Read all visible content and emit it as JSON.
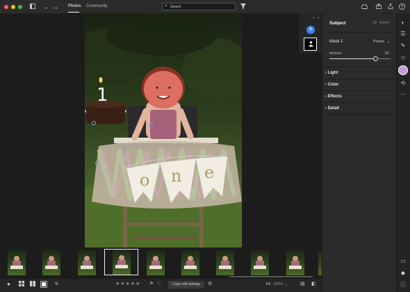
{
  "window": {
    "traffic_lights": [
      "#ff5f57",
      "#febc2e",
      "#28c840"
    ]
  },
  "toolbar": {
    "tabs": [
      {
        "label": "Photos",
        "active": true
      },
      {
        "label": "Community",
        "active": false
      }
    ],
    "search": {
      "placeholder": "Search"
    },
    "icons": [
      "sidebar-toggle-icon",
      "back-arrow-icon",
      "forward-arrow-icon",
      "search-icon",
      "filter-icon",
      "cloud-icon",
      "share-icon",
      "export-icon",
      "help-icon"
    ]
  },
  "masking": {
    "add_button_icon": "plus-icon",
    "mask_thumbnail_icon": "person-icon"
  },
  "panel": {
    "title": "Subject",
    "invert_label": "Invert",
    "mask_name": "Mask 1",
    "preset_label": "Preset",
    "amount": {
      "label": "Amount",
      "value": "50"
    },
    "sections": [
      "Light",
      "Color",
      "Effects",
      "Detail"
    ]
  },
  "rail": {
    "icons": [
      "edit-icon",
      "sliders-icon",
      "heal-icon",
      "eraser-icon",
      "masking-icon",
      "history-icon",
      "more-icon",
      "comment-icon",
      "tag-icon",
      "info-icon"
    ]
  },
  "photo": {
    "banner_letters": [
      "o",
      "n",
      "e"
    ],
    "candle_number": "1"
  },
  "filmstrip": {
    "selected_index": 3,
    "count": 10
  },
  "bottombar": {
    "copy_button": "Copy edit settings",
    "fit_label": "Fit",
    "zoom_label": "100%",
    "stars": "★★★★★"
  },
  "colors": {
    "accent": "#3a84f0",
    "mask_overlay": "#d8312c"
  }
}
